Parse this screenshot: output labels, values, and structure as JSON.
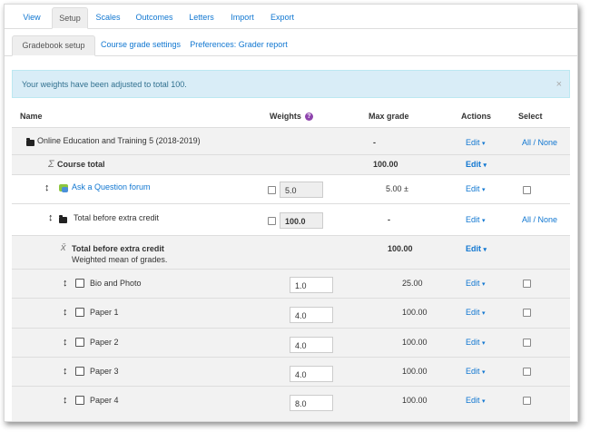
{
  "tabs": [
    "View",
    "Setup",
    "Scales",
    "Outcomes",
    "Letters",
    "Import",
    "Export"
  ],
  "subtabs": [
    "Gradebook setup",
    "Course grade settings",
    "Preferences: Grader report"
  ],
  "alert": {
    "message": "Your weights have been adjusted to total 100.",
    "close": "×"
  },
  "columns": {
    "name": "Name",
    "weights": "Weights",
    "max_grade": "Max grade",
    "actions": "Actions",
    "select": "Select",
    "help": "?"
  },
  "rows": [
    {
      "name": "Online Education and Training 5 (2018-2019)",
      "weight": "",
      "max": "-",
      "action": "Edit",
      "select": "All / None"
    },
    {
      "name": "Course total",
      "symbol": "Σ",
      "weight": "",
      "max": "100.00",
      "action": "Edit"
    },
    {
      "name": "Ask a Question forum",
      "weight": "5.0",
      "max": "5.00",
      "max_suffix": "±",
      "action": "Edit"
    },
    {
      "name": "Total before extra credit",
      "weight": "100.0",
      "max": "-",
      "action": "Edit",
      "select": "All / None"
    },
    {
      "name": "Total before extra credit",
      "symbol": "x̄",
      "subtext": "Weighted mean of grades.",
      "weight": "",
      "max": "100.00",
      "action": "Edit"
    },
    {
      "name": "Bio and Photo",
      "weight": "1.0",
      "max": "25.00",
      "action": "Edit"
    },
    {
      "name": "Paper 1",
      "weight": "4.0",
      "max": "100.00",
      "action": "Edit"
    },
    {
      "name": "Paper 2",
      "weight": "4.0",
      "max": "100.00",
      "action": "Edit"
    },
    {
      "name": "Paper 3",
      "weight": "4.0",
      "max": "100.00",
      "action": "Edit"
    },
    {
      "name": "Paper 4",
      "weight": "8.0",
      "max": "100.00",
      "action": "Edit"
    }
  ],
  "caret": "▾",
  "move_glyph": "↕"
}
